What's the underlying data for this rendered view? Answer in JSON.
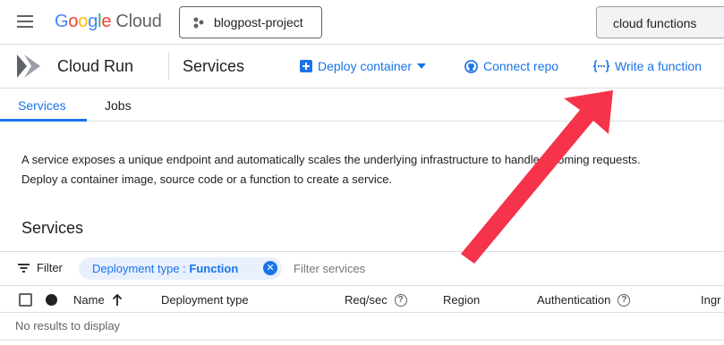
{
  "topbar": {
    "logo_letters": [
      "G",
      "o",
      "o",
      "g",
      "l",
      "e"
    ],
    "logo_suffix": "Cloud",
    "project_name": "blogpost-project",
    "search_value": "cloud functions",
    "icons": [
      "menu-icon",
      "project-dots-icon"
    ]
  },
  "subheader": {
    "product_title": "Cloud Run",
    "page_title": "Services",
    "actions": {
      "deploy_container": "Deploy container",
      "connect_repo": "Connect repo",
      "write_function": "Write a function"
    }
  },
  "tabs": {
    "services": "Services",
    "jobs": "Jobs",
    "active": "Services"
  },
  "description": {
    "line1": "A service exposes a unique endpoint and automatically scales the underlying infrastructure to handle incoming requests.",
    "line2": "Deploy a container image, source code or a function to create a service."
  },
  "section_title": "Services",
  "filter": {
    "label": "Filter",
    "chip_key": "Deployment type : ",
    "chip_value": "Function",
    "placeholder": "Filter services"
  },
  "table": {
    "columns": {
      "name": "Name",
      "deployment_type": "Deployment type",
      "req_sec": "Req/sec",
      "region": "Region",
      "authentication": "Authentication",
      "ingress": "Ingr"
    },
    "empty_message": "No results to display"
  },
  "colors": {
    "accent": "#1a73e8",
    "annotation_arrow": "#f5334b"
  }
}
